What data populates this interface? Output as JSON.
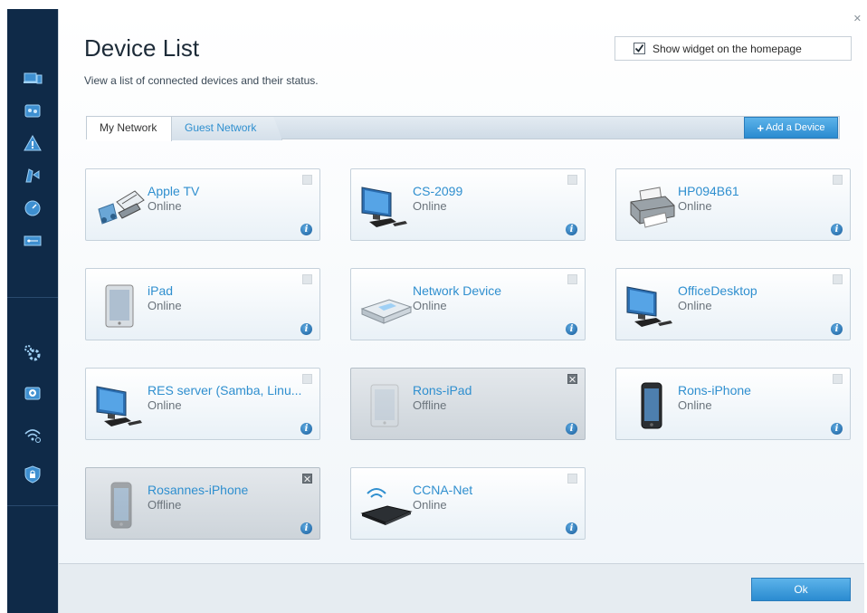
{
  "header": {
    "title": "Device List",
    "subtitle": "View a list of connected devices and their status.",
    "close_label": "✕",
    "widget_checkbox_label": "Show widget on the homepage",
    "widget_checked": true
  },
  "tabs": [
    {
      "label": "My Network",
      "active": true
    },
    {
      "label": "Guest Network",
      "active": false
    }
  ],
  "add_device_label": "Add a Device",
  "devices": [
    {
      "name": "Apple TV",
      "status": "Online",
      "icon": "media-icon"
    },
    {
      "name": "CS-2099",
      "status": "Online",
      "icon": "desktop-icon"
    },
    {
      "name": "HP094B61",
      "status": "Online",
      "icon": "printer-icon"
    },
    {
      "name": "iPad",
      "status": "Online",
      "icon": "tablet-icon"
    },
    {
      "name": "Network Device",
      "status": "Online",
      "icon": "network-device-icon"
    },
    {
      "name": "OfficeDesktop",
      "status": "Online",
      "icon": "desktop-icon"
    },
    {
      "name": "RES server (Samba, Linu...",
      "status": "Online",
      "icon": "desktop-icon"
    },
    {
      "name": "Rons-iPad",
      "status": "Offline",
      "icon": "tablet-icon"
    },
    {
      "name": "Rons-iPhone",
      "status": "Online",
      "icon": "phone-icon"
    },
    {
      "name": "Rosannes-iPhone",
      "status": "Offline",
      "icon": "phone-icon"
    },
    {
      "name": "CCNA-Net",
      "status": "Online",
      "icon": "router-icon"
    }
  ],
  "footer": {
    "ok_label": "Ok"
  },
  "rail_icons": [
    "devices-icon",
    "network-map-icon",
    "alert-icon",
    "parental-controls-icon",
    "speed-test-icon",
    "usb-storage-icon",
    "settings-icon",
    "troubleshooting-icon",
    "wireless-icon",
    "security-icon"
  ],
  "colors": {
    "accent": "#2f8fcf",
    "rail": "#0f2a48",
    "offline": "#cdd4da"
  }
}
